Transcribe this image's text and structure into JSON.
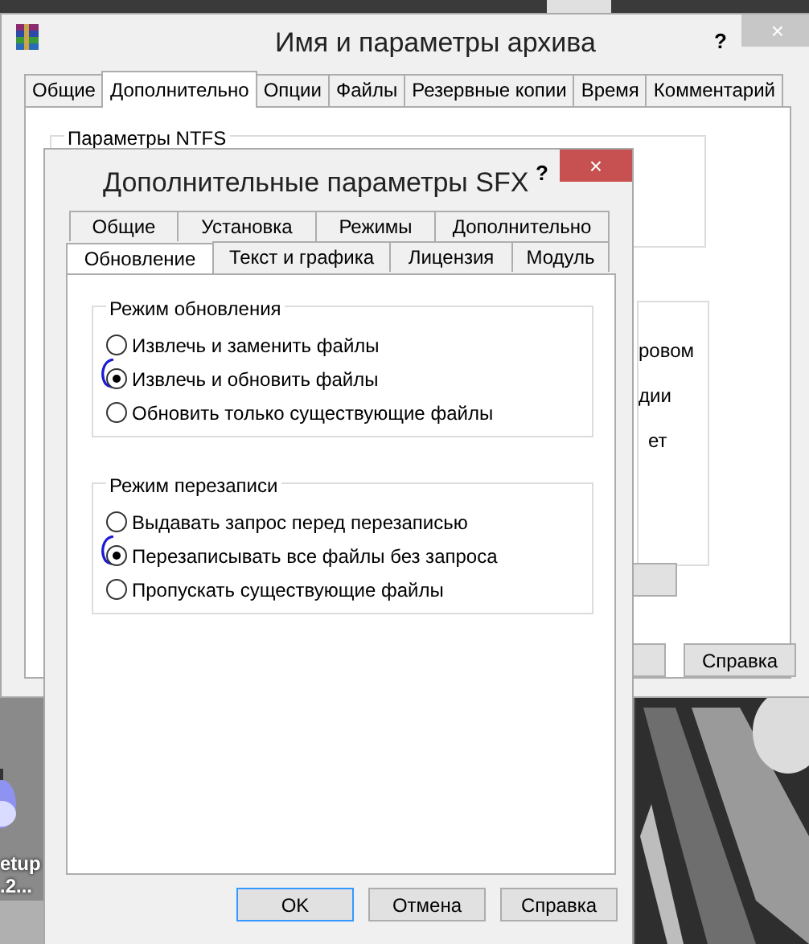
{
  "desktop": {
    "icon_labels": [
      "etup",
      ".2..."
    ]
  },
  "main_window": {
    "title": "Имя и параметры архива",
    "help_glyph": "?",
    "close_glyph": "×",
    "tabs": [
      {
        "label": "Общие",
        "selected": false
      },
      {
        "label": "Дополнительно",
        "selected": true
      },
      {
        "label": "Опции",
        "selected": false
      },
      {
        "label": "Файлы",
        "selected": false
      },
      {
        "label": "Резервные копии",
        "selected": false
      },
      {
        "label": "Время",
        "selected": false
      },
      {
        "label": "Комментарий",
        "selected": false
      }
    ],
    "group_title": "Параметры NTFS",
    "partial_texts": [
      "ровом",
      "дии",
      "ет"
    ],
    "buttons": [
      "Справка"
    ]
  },
  "sfx_dialog": {
    "title": "Дополнительные параметры SFX",
    "help_glyph": "?",
    "close_glyph": "×",
    "tab_rows": [
      [
        {
          "label": "Общие",
          "selected": false
        },
        {
          "label": "Установка",
          "selected": false
        },
        {
          "label": "Режимы",
          "selected": false
        },
        {
          "label": "Дополнительно",
          "selected": false
        }
      ],
      [
        {
          "label": "Обновление",
          "selected": true
        },
        {
          "label": "Текст и графика",
          "selected": false
        },
        {
          "label": "Лицензия",
          "selected": false
        },
        {
          "label": "Модуль",
          "selected": false
        }
      ]
    ],
    "groups": [
      {
        "title": "Режим обновления",
        "options": [
          {
            "label": "Извлечь и заменить файлы",
            "selected": false
          },
          {
            "label": "Извлечь и обновить файлы",
            "selected": true
          },
          {
            "label": "Обновить только существующие файлы",
            "selected": false
          }
        ]
      },
      {
        "title": "Режим перезаписи",
        "options": [
          {
            "label": "Выдавать запрос перед перезаписью",
            "selected": false
          },
          {
            "label": "Перезаписывать все файлы без запроса",
            "selected": true
          },
          {
            "label": "Пропускать существующие файлы",
            "selected": false
          }
        ]
      }
    ],
    "buttons": [
      {
        "label": "OK",
        "default": true
      },
      {
        "label": "Отмена",
        "default": false
      },
      {
        "label": "Справка",
        "default": false
      }
    ]
  }
}
